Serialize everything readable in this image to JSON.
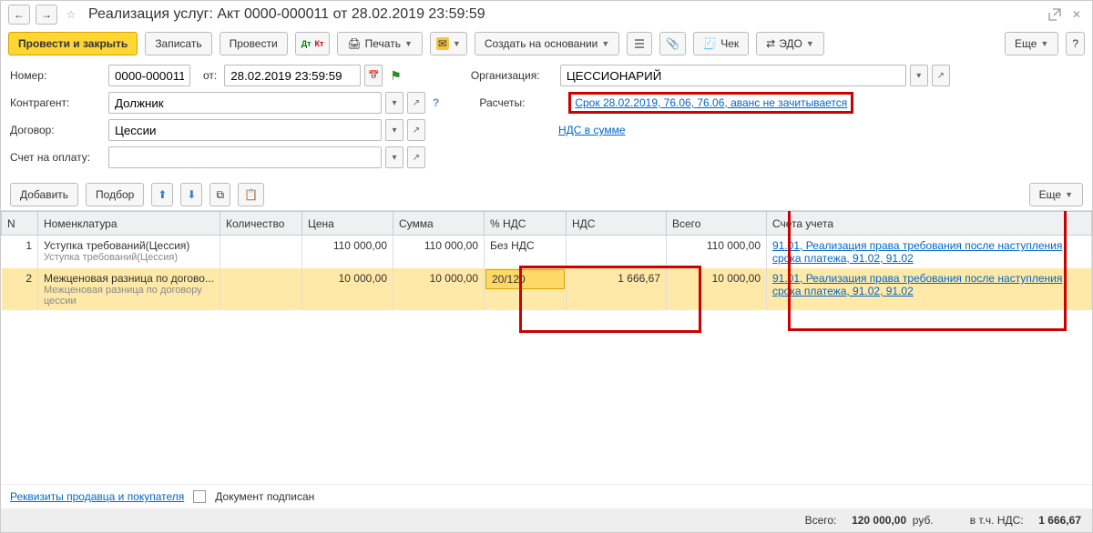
{
  "titlebar": {
    "title": "Реализация услуг: Акт 0000-000011 от 28.02.2019 23:59:59"
  },
  "toolbar": {
    "post_close": "Провести и закрыть",
    "save": "Записать",
    "post": "Провести",
    "print": "Печать",
    "create_based": "Создать на основании",
    "receipt": "Чек",
    "edo": "ЭДО",
    "more": "Еще",
    "help": "?"
  },
  "form": {
    "number_label": "Номер:",
    "number_value": "0000-000011",
    "from_label": "от:",
    "date_value": "28.02.2019 23:59:59",
    "org_label": "Организация:",
    "org_value": "ЦЕССИОНАРИЙ",
    "counterparty_label": "Контрагент:",
    "counterparty_value": "Должник",
    "settlements_label": "Расчеты:",
    "settlements_link": "Срок 28.02.2019, 76.06, 76.06, аванс не зачитывается",
    "contract_label": "Договор:",
    "contract_value": "Цессии",
    "vat_in_sum": "НДС в сумме",
    "invoice_label": "Счет на оплату:",
    "invoice_value": ""
  },
  "tbl_toolbar": {
    "add": "Добавить",
    "pick": "Подбор",
    "more2": "Еще"
  },
  "cols": {
    "n": "N",
    "item": "Номенклатура",
    "qty": "Количество",
    "price": "Цена",
    "sum": "Сумма",
    "vat_rate": "% НДС",
    "vat": "НДС",
    "total": "Всего",
    "accounts": "Счета учета"
  },
  "rows": [
    {
      "n": "1",
      "item": "Уступка требований(Цессия)",
      "item_sub": "Уступка требований(Цессия)",
      "qty": "",
      "price": "110 000,00",
      "sum": "110 000,00",
      "vat_rate": "Без НДС",
      "vat": "",
      "total": "110 000,00",
      "accounts": "91.01, Реализация права требования после наступления срока платежа, 91.02, 91.02"
    },
    {
      "n": "2",
      "item": "Межценовая разница по догово...",
      "item_sub": "Межценовая разница по договору цессии",
      "qty": "",
      "price": "10 000,00",
      "sum": "10 000,00",
      "vat_rate": "20/120",
      "vat": "1 666,67",
      "total": "10 000,00",
      "accounts": "91.01, Реализация права требования после наступления срока платежа, 91.02, 91.02"
    }
  ],
  "footer": {
    "seller_buyer": "Реквизиты продавца и покупателя",
    "doc_signed": "Документ подписан",
    "total_label": "Всего:",
    "total_value": "120 000,00",
    "currency": "руб.",
    "vat_label": "в т.ч. НДС:",
    "vat_value": "1 666,67"
  }
}
